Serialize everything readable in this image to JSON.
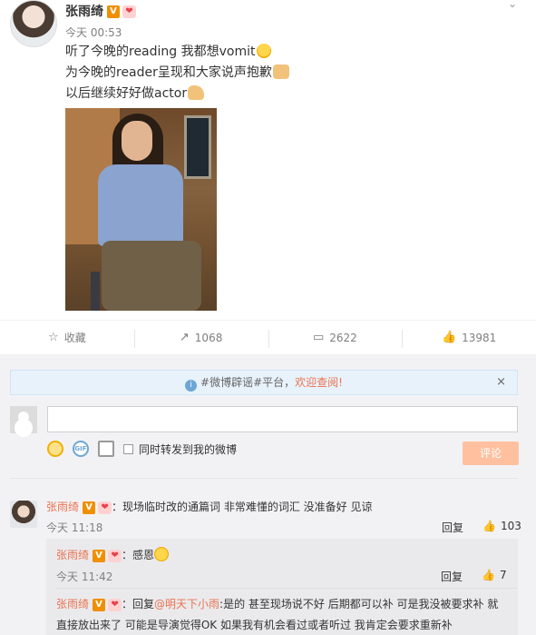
{
  "post": {
    "author": "张雨绮",
    "v_badge": "V",
    "time": "今天 00:53",
    "lines": [
      "听了今晚的reading 我都想vomit",
      "为今晚的reader呈现和大家说声抱歉",
      "以后继续好好做actor"
    ]
  },
  "actions": {
    "favorite": "收藏",
    "repost_count": "1068",
    "comment_count": "2622",
    "like_count": "13981"
  },
  "notice": {
    "text": "#微博辟谣#平台，",
    "link": "欢迎查阅!",
    "close": "×"
  },
  "composer": {
    "sync_label": "同时转发到我的微博",
    "submit_label": "评论",
    "gif_label": "GIF"
  },
  "comments": [
    {
      "author": "张雨绮",
      "text": "：现场临时改的通篇词 非常难懂的词汇 没准备好 见谅",
      "time": "今天 11:18",
      "reply_label": "回复",
      "likes": "103"
    }
  ],
  "replies": [
    {
      "author": "张雨绮",
      "text": "：感恩",
      "time": "今天 11:42",
      "reply_label": "回复",
      "likes": "7"
    },
    {
      "author": "张雨绮",
      "prefix": "：回复",
      "mention": "@明天下小雨",
      "text_line1": ":是的 甚至现场说不好 后期都可以补 可是我没被要求补 就",
      "text_line2": "直接放出来了 可能是导演觉得OK 如果我有机会看过或者听过 我肯定会要求重新补"
    }
  ]
}
